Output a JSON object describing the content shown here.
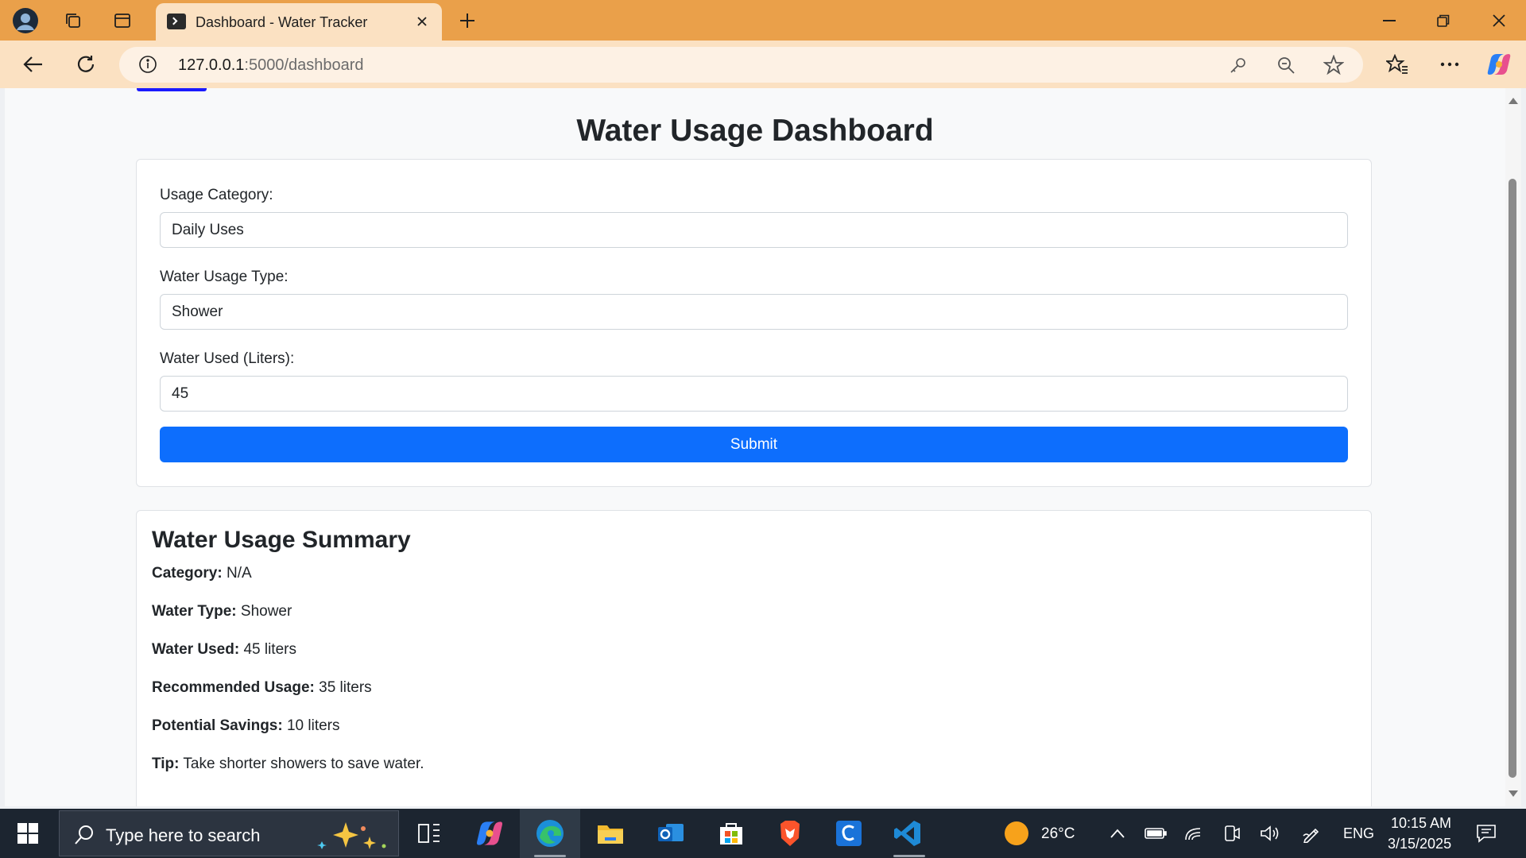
{
  "browser": {
    "tab_title": "Dashboard - Water Tracker",
    "url_host": "127.0.0.1",
    "url_path": ":5000/dashboard"
  },
  "page": {
    "title": "Water Usage Dashboard"
  },
  "form": {
    "category_label": "Usage Category:",
    "category_value": "Daily Uses",
    "type_label": "Water Usage Type:",
    "type_value": "Shower",
    "used_label": "Water Used (Liters):",
    "used_value": "45",
    "submit_label": "Submit"
  },
  "summary": {
    "title": "Water Usage Summary",
    "rows": [
      {
        "label": "Category:",
        "value": "N/A"
      },
      {
        "label": "Water Type:",
        "value": "Shower"
      },
      {
        "label": "Water Used:",
        "value": "45 liters"
      },
      {
        "label": "Recommended Usage:",
        "value": "35 liters"
      },
      {
        "label": "Potential Savings:",
        "value": "10 liters"
      },
      {
        "label": "Tip:",
        "value": "Take shorter showers to save water."
      }
    ]
  },
  "taskbar": {
    "search_placeholder": "Type here to search",
    "temperature": "26°C",
    "language": "ENG",
    "time": "10:15 AM",
    "date": "3/15/2025"
  },
  "colors": {
    "titlebar": "#eaa04a",
    "tab": "#fbe1c2",
    "primary": "#0d6efd",
    "taskbar": "#1c2530"
  }
}
